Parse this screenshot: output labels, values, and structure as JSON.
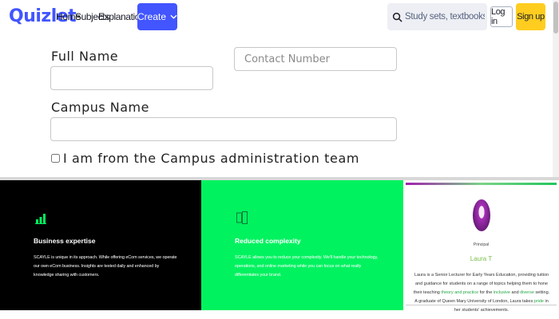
{
  "header": {
    "logo": "Quizlet",
    "nav": [
      "Home",
      "Subjects",
      "Explanations"
    ],
    "create_label": "Create",
    "search_placeholder": "Study sets, textbooks, ...",
    "login_label": "Log in",
    "signup_label": "Sign up"
  },
  "form": {
    "full_name_label": "Full Name",
    "full_name_value": "",
    "contact_placeholder": "Contact Number",
    "campus_label": "Campus Name",
    "campus_value": "",
    "admin_checkbox_label": "I am from the Campus administration team",
    "admin_checked": false
  },
  "features": [
    {
      "title": "Business expertise",
      "text": "SCAYLE is unique in its approach. While offering eCom services, we operate our own eCom business. Insights are tested daily and enhanced by knowledge sharing with customers."
    },
    {
      "title": "Reduced complexity",
      "text": "SCAYLE allows you to reduce your complexity. We'll handle your technology, operations, and online marketing while you can focus on what really differentiates your brand."
    }
  ],
  "profile_card": {
    "role": "Principal",
    "name": "Laura T",
    "bio_parts": [
      {
        "text": "Laura is a Senior Lecturer for Early Years Education, providing tuition and guidance for students on a range of topics helping them to ",
        "green": false
      },
      {
        "text": "hone their teaching",
        "green": false
      },
      {
        "text": " ",
        "green": false
      },
      {
        "text": "theory and practice",
        "green": true
      },
      {
        "text": " for the ",
        "green": false
      },
      {
        "text": "inclusive",
        "green": true
      },
      {
        "text": " and ",
        "green": false
      },
      {
        "text": "diverse",
        "green": true
      },
      {
        "text": " setting. A graduate of Queen Mary University of London, Laura takes ",
        "green": false
      },
      {
        "text": "pride",
        "green": true
      },
      {
        "text": " in her students' achievements.",
        "green": false
      }
    ]
  },
  "colors": {
    "brand": "#4255ff",
    "signup": "#ffcd1f",
    "panel_black": "#000000",
    "panel_green": "#00f25f",
    "accent_green": "#22a845"
  }
}
